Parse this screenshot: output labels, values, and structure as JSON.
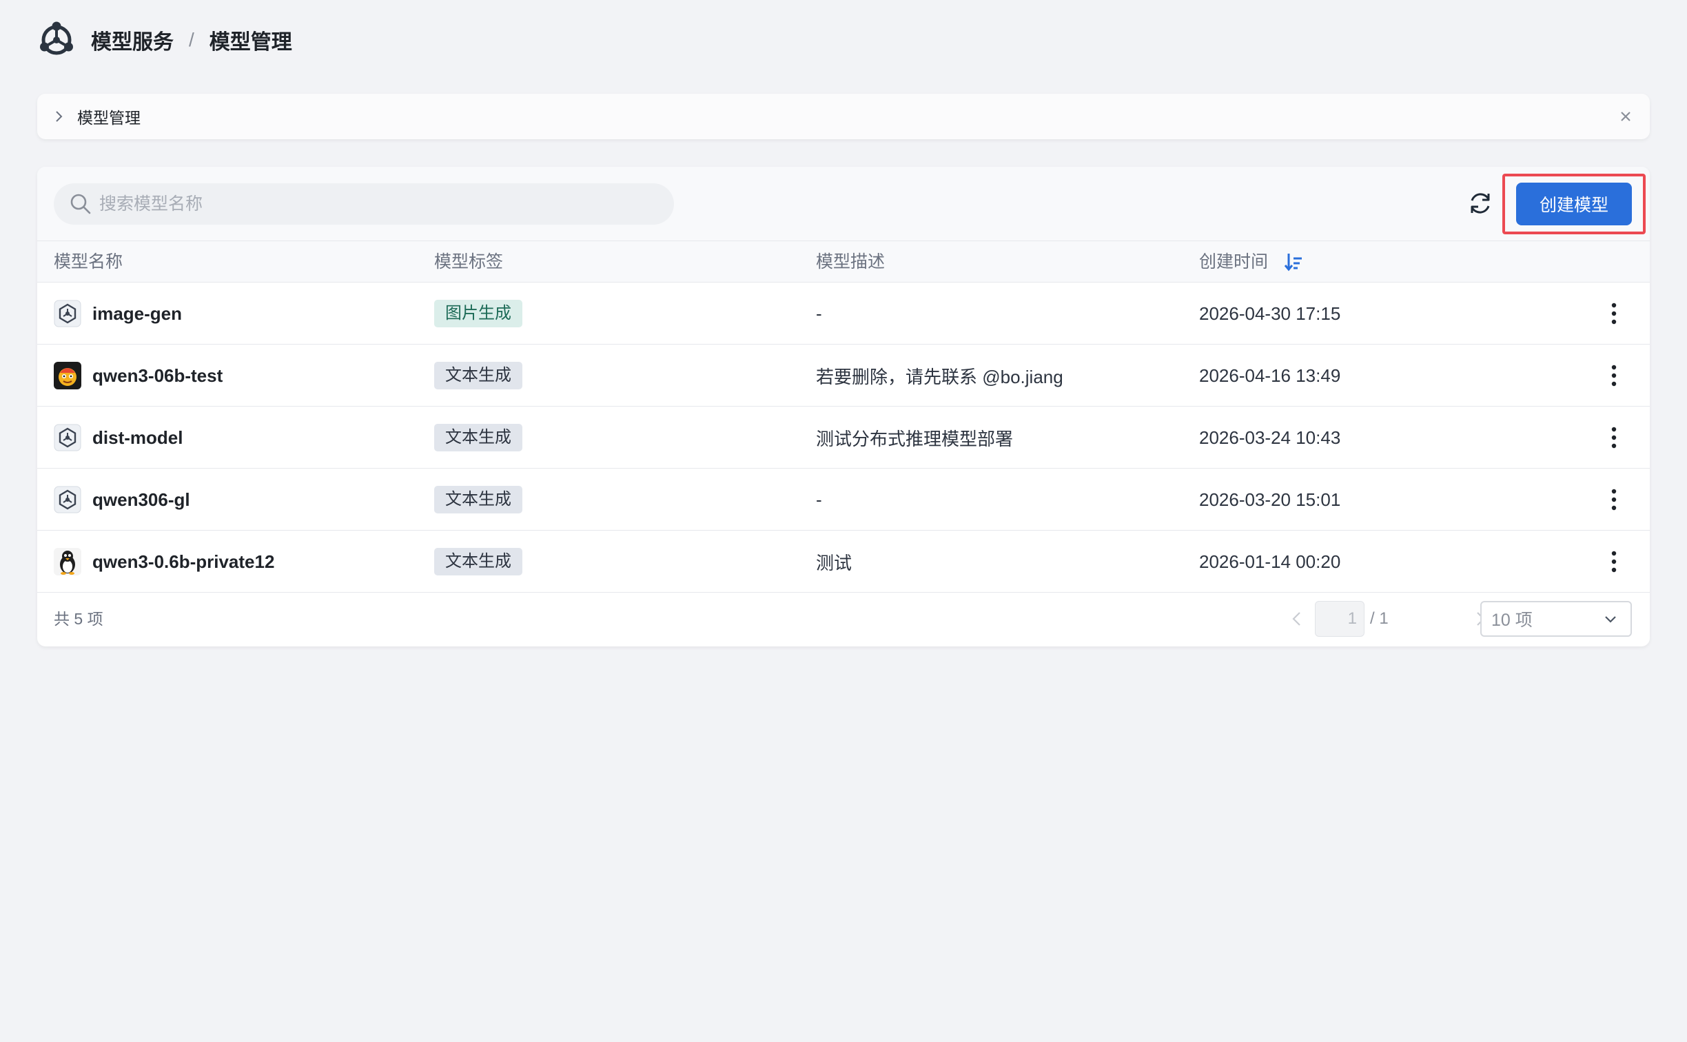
{
  "header": {
    "breadcrumb_parent": "模型服务",
    "separator": "/",
    "breadcrumb_current": "模型管理"
  },
  "tab": {
    "label": "模型管理"
  },
  "toolbar": {
    "search_placeholder": "搜索模型名称",
    "create_label": "创建模型"
  },
  "table": {
    "columns": {
      "name": "模型名称",
      "tags": "模型标签",
      "description": "模型描述",
      "created": "创建时间"
    },
    "rows": [
      {
        "name": "image-gen",
        "avatar": "model-icon",
        "tag": "图片生成",
        "description": "-",
        "created": "2026-04-30 17:15"
      },
      {
        "name": "qwen3-06b-test",
        "avatar": "emoji-avatar",
        "tag": "文本生成",
        "description": "若要删除，请先联系 @bo.jiang",
        "created": "2026-04-16 13:49"
      },
      {
        "name": "dist-model",
        "avatar": "model-icon",
        "tag": "文本生成",
        "description": "测试分布式推理模型部署",
        "created": "2026-03-24 10:43"
      },
      {
        "name": "qwen306-gl",
        "avatar": "model-icon",
        "tag": "文本生成",
        "description": "-",
        "created": "2026-03-20 15:01"
      },
      {
        "name": "qwen3-0.6b-private12",
        "avatar": "penguin-avatar",
        "tag": "文本生成",
        "description": "测试",
        "created": "2026-01-14 00:20"
      }
    ]
  },
  "pagination": {
    "total_text": "共 5 项",
    "current_page": "1",
    "total_pages": "/ 1",
    "page_size": "10 项"
  },
  "colors": {
    "primary": "#2a6fdb",
    "highlight_border": "#ec4a52",
    "tag_image_bg": "#dbeeea",
    "tag_text_bg": "#e1e5ec",
    "page_bg": "#f2f3f6"
  }
}
